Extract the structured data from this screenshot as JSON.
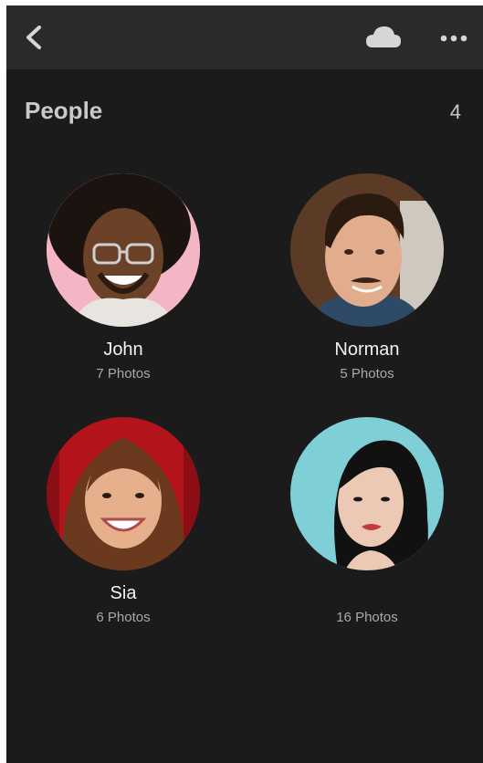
{
  "header": {
    "back_icon": "chevron-left-icon",
    "cloud_icon": "cloud-icon",
    "more_icon": "more-horizontal-icon"
  },
  "section": {
    "title": "People",
    "count": "4"
  },
  "people": [
    {
      "name": "John",
      "photos": "7 Photos",
      "bg": "#f4b6c4"
    },
    {
      "name": "Norman",
      "photos": "5 Photos",
      "bg": "#6a4a32"
    },
    {
      "name": "Sia",
      "photos": "6 Photos",
      "bg": "#b3141c"
    },
    {
      "name": "",
      "photos": "16 Photos",
      "bg": "#7fcfd6"
    }
  ],
  "colors": {
    "screen_bg": "#1b1b1b",
    "topbar_bg": "#2a2a2a",
    "text_primary": "#f2f2f2",
    "text_secondary": "#a9a9a9"
  }
}
